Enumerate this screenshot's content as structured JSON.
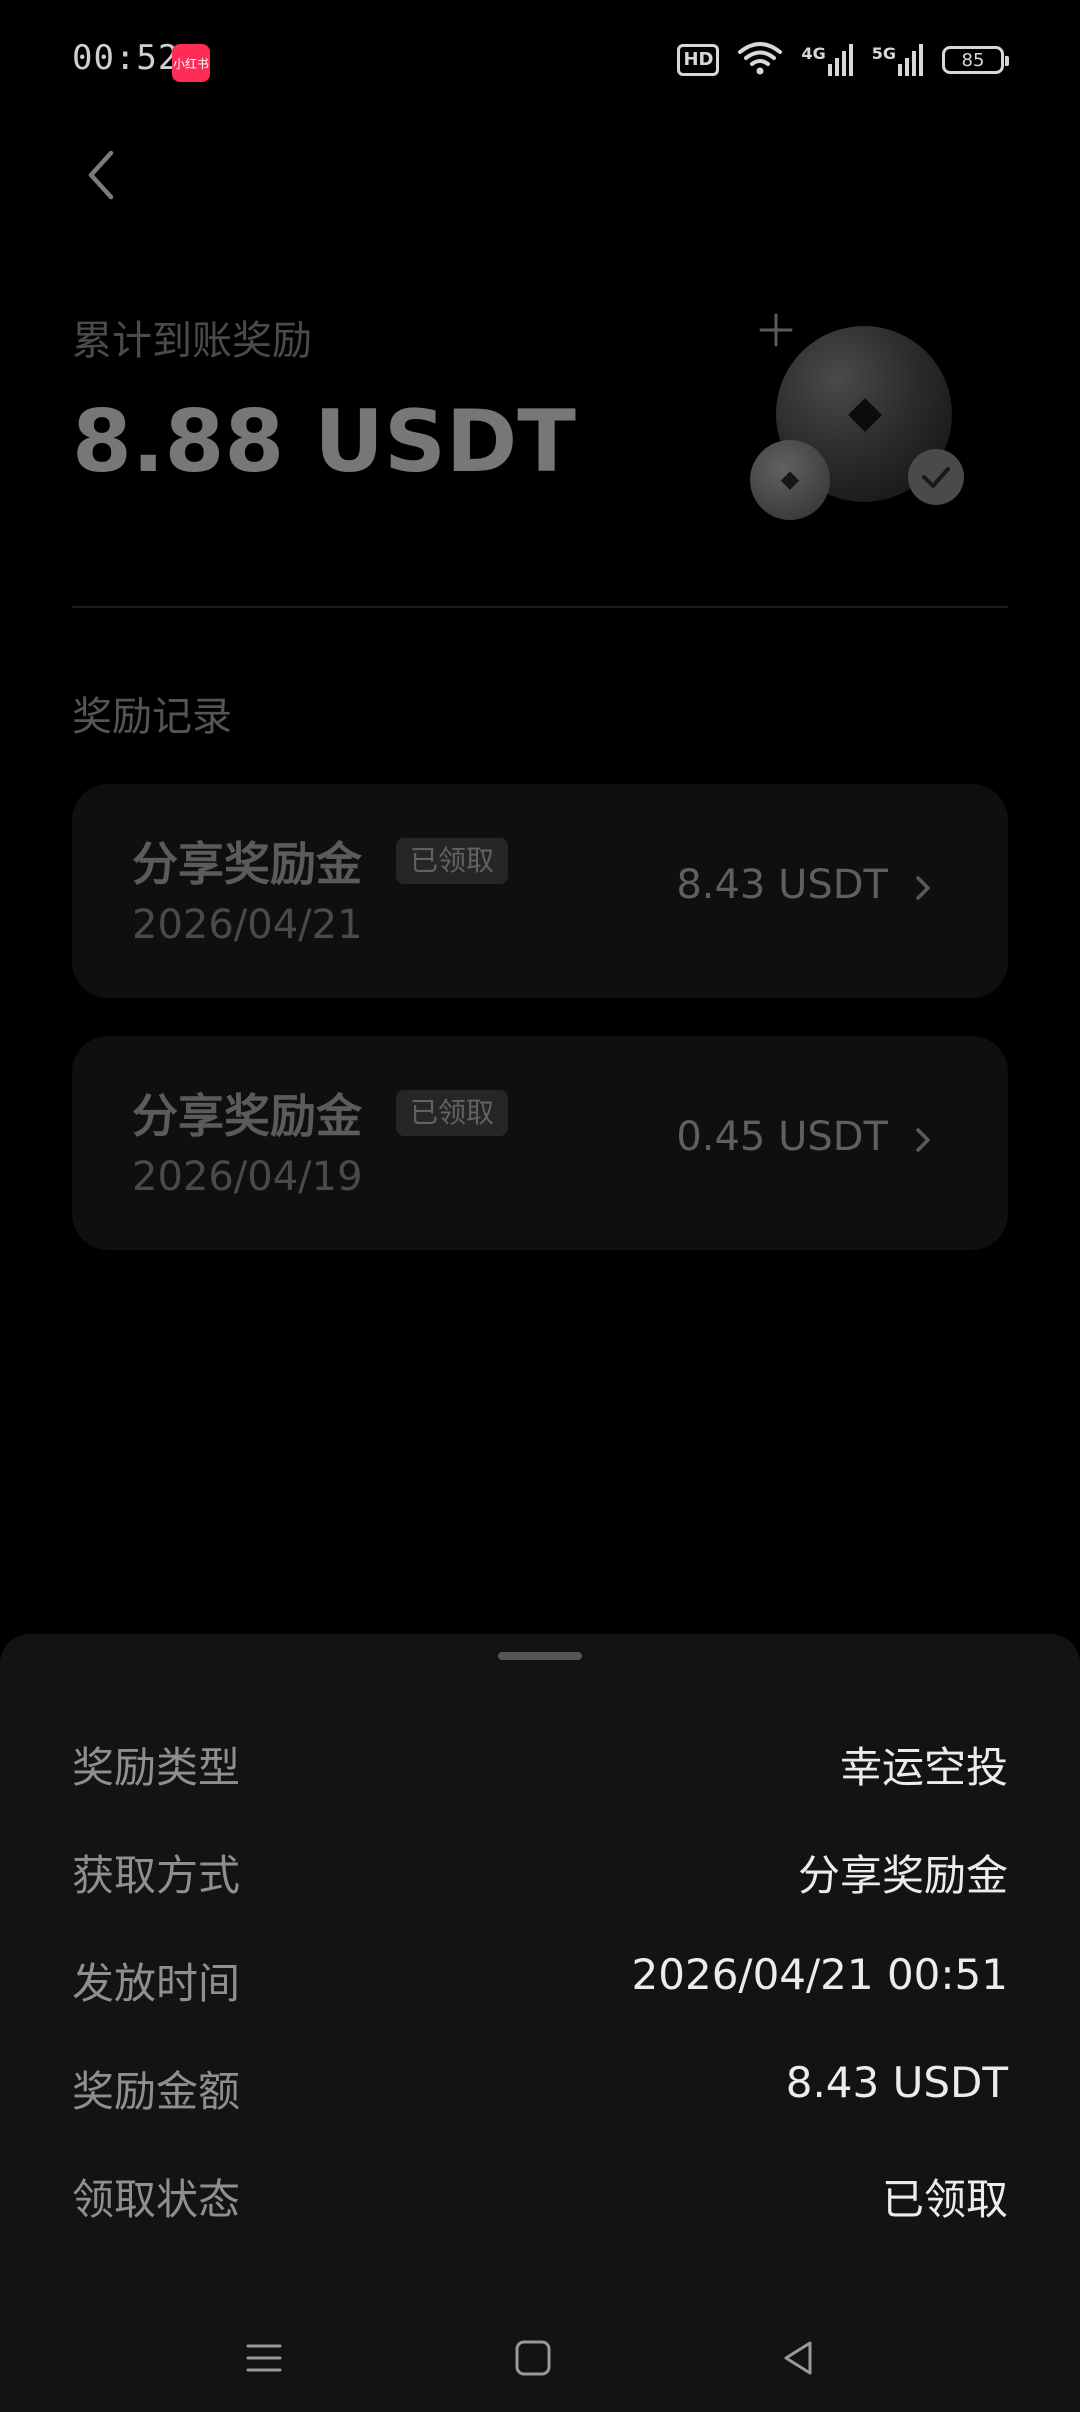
{
  "status_bar": {
    "time": "00:52",
    "app_badge": "小红书",
    "hd": "HD",
    "net1": "4G",
    "net2": "5G",
    "battery": "85"
  },
  "summary": {
    "label": "累计到账奖励",
    "amount": "8.88 USDT"
  },
  "records": {
    "title": "奖励记录",
    "items": [
      {
        "title": "分享奖励金",
        "badge": "已领取",
        "date": "2026/04/21",
        "amount": "8.43 USDT"
      },
      {
        "title": "分享奖励金",
        "badge": "已领取",
        "date": "2026/04/19",
        "amount": "0.45 USDT"
      }
    ]
  },
  "sheet": {
    "rows": [
      {
        "key": "奖励类型",
        "value": "幸运空投"
      },
      {
        "key": "获取方式",
        "value": "分享奖励金"
      },
      {
        "key": "发放时间",
        "value": "2026/04/21 00:51"
      },
      {
        "key": "奖励金额",
        "value": "8.43 USDT"
      },
      {
        "key": "领取状态",
        "value": "已领取"
      }
    ]
  }
}
